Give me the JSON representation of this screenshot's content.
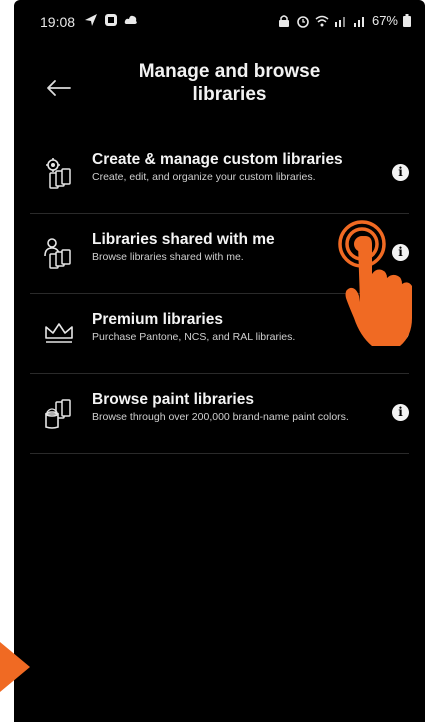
{
  "status_bar": {
    "time": "19:08",
    "battery": "67%"
  },
  "header": {
    "title_line1": "Manage and browse",
    "title_line2": "libraries",
    "back_icon": "arrow-left-icon"
  },
  "items": [
    {
      "title": "Create & manage custom libraries",
      "subtitle": "Create, edit, and organize your custom libraries.",
      "icon": "gear-library-icon"
    },
    {
      "title": "Libraries shared with me",
      "subtitle": "Browse libraries shared with me.",
      "icon": "person-library-icon"
    },
    {
      "title": "Premium libraries",
      "subtitle": "Purchase Pantone, NCS, and RAL libraries.",
      "icon": "crown-icon"
    },
    {
      "title": "Browse paint libraries",
      "subtitle": "Browse through over 200,000 brand-name paint colors.",
      "icon": "paint-can-library-icon"
    }
  ],
  "info_glyph": "i",
  "colors": {
    "background": "#000000",
    "text": "#f4f4f4",
    "accent_overlay": "#f06a23"
  }
}
